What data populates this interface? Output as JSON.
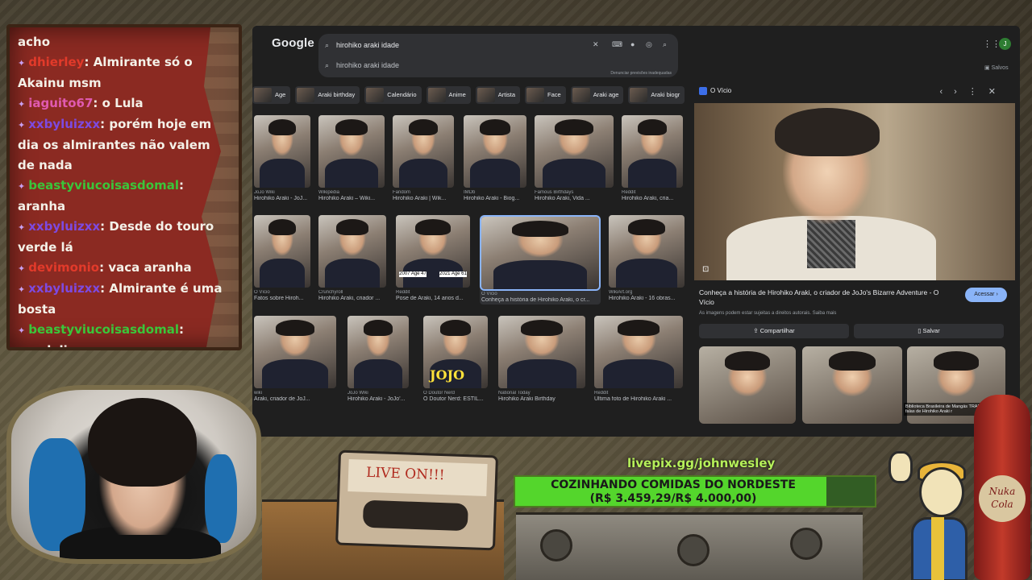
{
  "chat": {
    "lines": [
      {
        "user": "",
        "text": "acho",
        "color": "#f4f1e8"
      },
      {
        "user": "dhierley",
        "text": "Almirante só o Akainu msm",
        "color": "#e23a2a"
      },
      {
        "user": "iaguito67",
        "text": "o Lula",
        "color": "#e05ab0"
      },
      {
        "user": "xxbyluizxx",
        "text": "porém hoje em dia os almirantes não valem de nada",
        "color": "#7d4ae0"
      },
      {
        "user": "beastyviucoisasdomal",
        "text": "aranha",
        "color": "#3ac63a"
      },
      {
        "user": "xxbyluizxx",
        "text": "Desde do touro verde lá",
        "color": "#7d4ae0"
      },
      {
        "user": "devimonio",
        "text": "vaca aranha",
        "color": "#e23a2a"
      },
      {
        "user": "xxbyluizxx",
        "text": "Almirante é uma bosta",
        "color": "#7d4ae0"
      },
      {
        "user": "beastyviucoisasdomal",
        "text": "vandalizaram",
        "color": "#3ac63a"
      }
    ]
  },
  "browser": {
    "logo": "Google",
    "query": "hirohiko araki idade",
    "suggestion": "hirohiko araki idade",
    "report_link": "Denunciar previsões inadequadas",
    "saved_label": "Salvos",
    "avatar_letter": "J",
    "chips": [
      "Age",
      "Araki birthday",
      "Calendário",
      "Anime",
      "Artista",
      "Face",
      "Araki age",
      "Araki biogr"
    ],
    "grid_row1": [
      {
        "source": "JoJo Wiki",
        "caption": "Hirohiko Araki - JoJ..."
      },
      {
        "source": "Wikipédia",
        "caption": "Hirohiko Araki – Wiki..."
      },
      {
        "source": "Fandom",
        "caption": "Hirohiko Araki | Wik..."
      },
      {
        "source": "IMDb",
        "caption": "Hirohiko Araki - Biog..."
      },
      {
        "source": "Famous Birthdays",
        "caption": "Hirohiko Araki, Vida ..."
      },
      {
        "source": "Reddit",
        "caption": "Hirohiko Araki, cria..."
      }
    ],
    "grid_row2": [
      {
        "source": "O Vício",
        "caption": "Fatos sobre Hiroh..."
      },
      {
        "source": "Crunchyroll",
        "caption": "Hirohiko Araki, criador ..."
      },
      {
        "source": "Reddit",
        "caption": "Pose de Araki, 14 anos d..."
      },
      {
        "source": "O Vício",
        "caption": "Conheça a história de Hirohiko Araki, o cr..."
      },
      {
        "source": "WikiArt.org",
        "caption": "Hirohiko Araki - 16 obras..."
      }
    ],
    "grid_row3": [
      {
        "source": "wiki",
        "caption": "Araki, criador de JoJ..."
      },
      {
        "source": "JoJo Wiki",
        "caption": "Hirohiko Araki - JoJo'..."
      },
      {
        "source": "O Doutor Nerd",
        "caption": "O Doutor Nerd: ESTIL..."
      },
      {
        "source": "National Today",
        "caption": "Hirohiko Araki Birthday"
      },
      {
        "source": "Reddit",
        "caption": "Última foto de Hirohiko Araki ..."
      }
    ],
    "overlay_age_left": "2007 Age 47",
    "overlay_age_right": "2021 Age 61",
    "jojo_label": "JOJO",
    "panel": {
      "site": "O Vício",
      "title": "Conheça a história de Hirohiko Araki, o criador de JoJo's Bizarre Adventure - O Vício",
      "visit_label": "Acessar",
      "note": "As imagens podem estar sujeitas a direitos autorais. Saiba mais",
      "share_label": "Compartilhar",
      "save_label": "Salvar",
      "related_caption": "Biblioteca Brasileira de Mangás TRADUÇÃO] As falas de Hirohiko Araki r"
    }
  },
  "overlay": {
    "livepix": "livepix.gg/johnwesley",
    "goal_title": "COZINHANDO COMIDAS DO NORDESTE",
    "goal_amount": "(R$ 3.459,29/R$ 4.000,00)",
    "goal_progress": 0.865,
    "cassette_label": "LIVE ON!!!",
    "bottle_label": "Nuka Cola"
  },
  "colors": {
    "accent": "#8ab4f8",
    "goal_fill": "#54d62c"
  }
}
